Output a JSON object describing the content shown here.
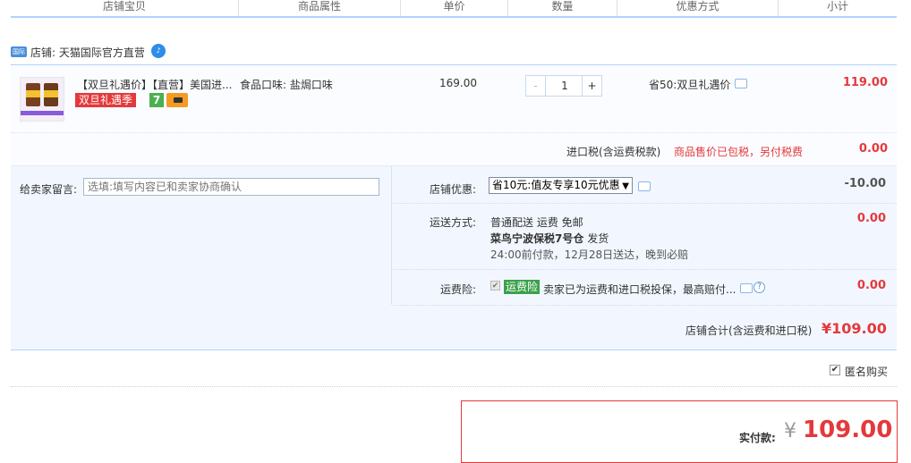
{
  "header": {
    "columns": [
      "店铺宝贝",
      "商品属性",
      "单价",
      "数量",
      "优惠方式",
      "小计"
    ]
  },
  "shop": {
    "badge": "国际",
    "name": "店铺: 天猫国际官方直营",
    "chat": "♪"
  },
  "item": {
    "title": "【双旦礼遇价】【直营】美国进...",
    "promo_tag": "双旦礼遇季",
    "tag_seven": "7",
    "attribute": "食品口味: 盐焗口味",
    "unit_price": "169.00",
    "quantity": "1",
    "minus": "-",
    "plus": "+",
    "discount": "省50:双旦礼遇价",
    "subtotal": "119.00"
  },
  "tax": {
    "label": "进口税(含运费税款)",
    "note": "商品售价已包税，另付税费",
    "value": "0.00"
  },
  "memo": {
    "label": "给卖家留言:",
    "placeholder": "选填:填写内容已和卖家协商确认"
  },
  "shop_discount": {
    "label": "店铺优惠:",
    "selected": "省10元:值友专享10元优惠",
    "caret": "▼",
    "value": "-10.00"
  },
  "shipping": {
    "label": "运送方式:",
    "line1": "普通配送 运费 免邮",
    "warehouse": "菜鸟宁波保税7号仓",
    "warehouse_suffix": "发货",
    "line3": "24:00前付款，12月28日送达，晚到必赔",
    "value": "0.00"
  },
  "insurance": {
    "label": "运费险:",
    "check": "✔",
    "badge": "运费险",
    "text": "卖家已为运费和进口税投保，最高赔付...",
    "help": "?",
    "value": "0.00"
  },
  "shop_total": {
    "label": "店铺合计(含运费和进口税)",
    "value": "¥109.00"
  },
  "anonymous": {
    "check": "✔",
    "label": "匿名购买"
  },
  "payment": {
    "label": "实付款:",
    "currency": "¥",
    "amount": "109.00"
  }
}
